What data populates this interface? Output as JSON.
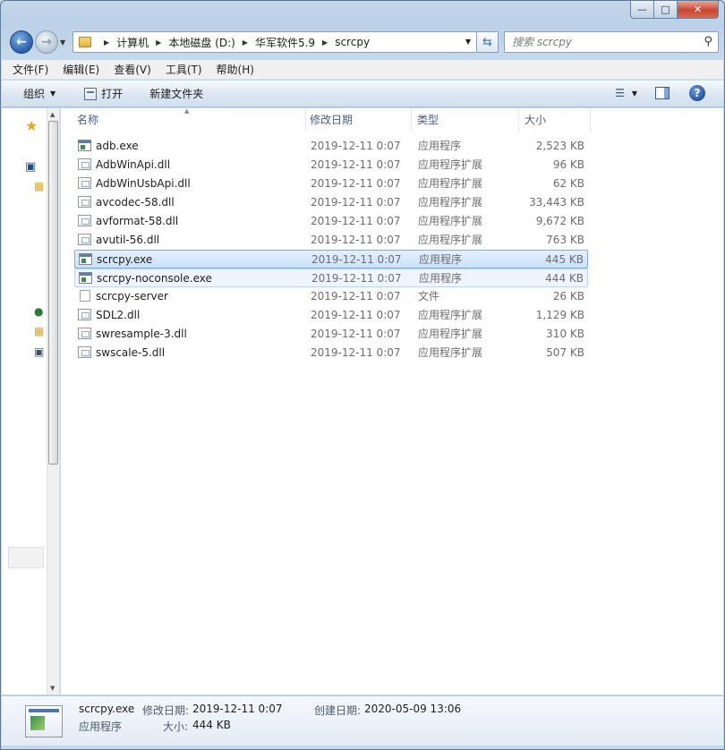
{
  "window": {
    "buttons": {
      "minimize": "—",
      "maximize": "□",
      "close": "✕"
    }
  },
  "nav": {
    "breadcrumb": [
      "计算机",
      "本地磁盘 (D:)",
      "华军软件5.9",
      "scrcpy"
    ],
    "search_placeholder": "搜索 scrcpy"
  },
  "menubar": [
    "文件(F)",
    "编辑(E)",
    "查看(V)",
    "工具(T)",
    "帮助(H)"
  ],
  "toolbar": {
    "organize": "组织",
    "open": "打开",
    "new_folder": "新建文件夹"
  },
  "columns": {
    "name": "名称",
    "date": "修改日期",
    "type": "类型",
    "size": "大小"
  },
  "files": [
    {
      "name": "adb.exe",
      "date": "2019-12-11 0:07",
      "type": "应用程序",
      "size": "2,523 KB",
      "icon": "exe"
    },
    {
      "name": "AdbWinApi.dll",
      "date": "2019-12-11 0:07",
      "type": "应用程序扩展",
      "size": "96 KB",
      "icon": "dll"
    },
    {
      "name": "AdbWinUsbApi.dll",
      "date": "2019-12-11 0:07",
      "type": "应用程序扩展",
      "size": "62 KB",
      "icon": "dll"
    },
    {
      "name": "avcodec-58.dll",
      "date": "2019-12-11 0:07",
      "type": "应用程序扩展",
      "size": "33,443 KB",
      "icon": "dll"
    },
    {
      "name": "avformat-58.dll",
      "date": "2019-12-11 0:07",
      "type": "应用程序扩展",
      "size": "9,672 KB",
      "icon": "dll"
    },
    {
      "name": "avutil-56.dll",
      "date": "2019-12-11 0:07",
      "type": "应用程序扩展",
      "size": "763 KB",
      "icon": "dll"
    },
    {
      "name": "scrcpy.exe",
      "date": "2019-12-11 0:07",
      "type": "应用程序",
      "size": "445 KB",
      "icon": "exe"
    },
    {
      "name": "scrcpy-noconsole.exe",
      "date": "2019-12-11 0:07",
      "type": "应用程序",
      "size": "444 KB",
      "icon": "exe"
    },
    {
      "name": "scrcpy-server",
      "date": "2019-12-11 0:07",
      "type": "文件",
      "size": "26 KB",
      "icon": "file"
    },
    {
      "name": "SDL2.dll",
      "date": "2019-12-11 0:07",
      "type": "应用程序扩展",
      "size": "1,129 KB",
      "icon": "dll"
    },
    {
      "name": "swresample-3.dll",
      "date": "2019-12-11 0:07",
      "type": "应用程序扩展",
      "size": "310 KB",
      "icon": "dll"
    },
    {
      "name": "swscale-5.dll",
      "date": "2019-12-11 0:07",
      "type": "应用程序扩展",
      "size": "507 KB",
      "icon": "dll"
    }
  ],
  "details": {
    "name": "scrcpy.exe",
    "type": "应用程序",
    "modified_label": "修改日期:",
    "modified": "2019-12-11 0:07",
    "created_label": "创建日期:",
    "created": "2020-05-09 13:06",
    "size_label": "大小:",
    "size": "444 KB"
  }
}
